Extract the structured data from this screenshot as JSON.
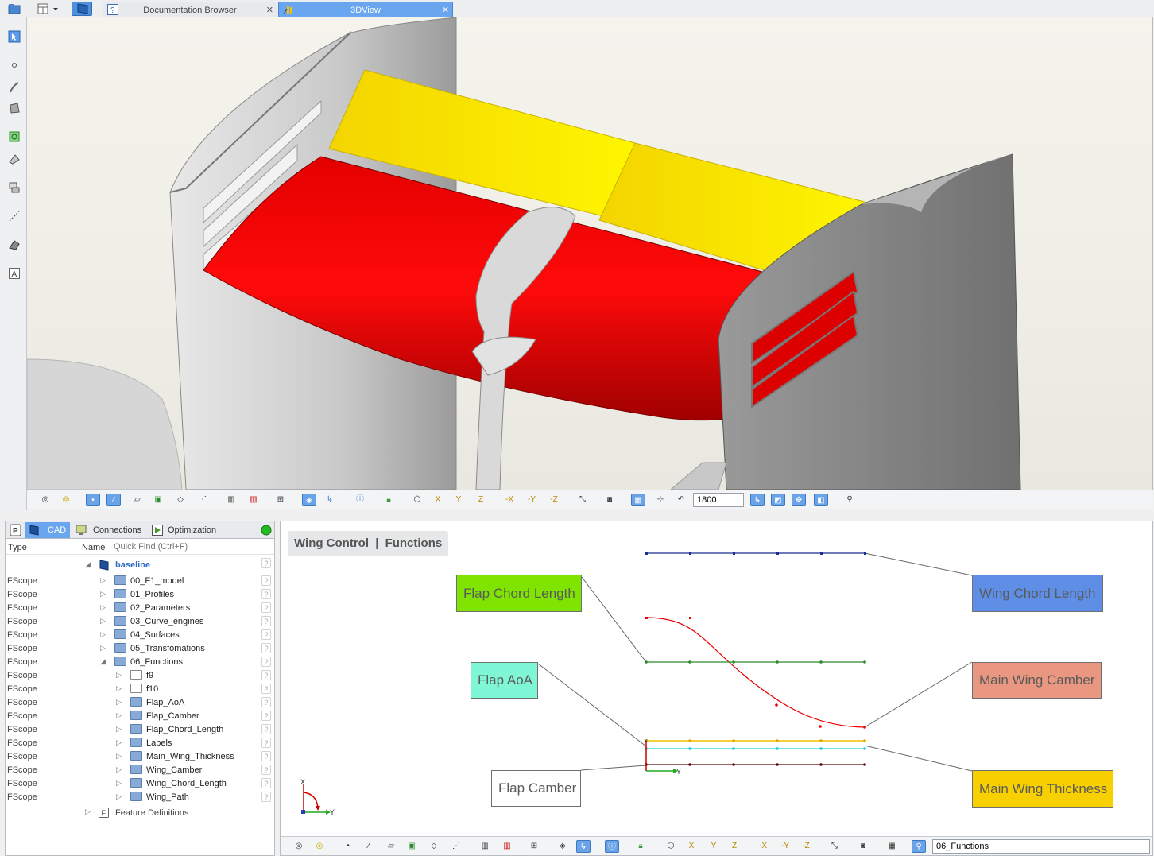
{
  "tabs": {
    "doc": "Documentation Browser",
    "view3d": "3DView"
  },
  "viewport": {
    "zoom_value": "1800",
    "toolbar_labels": [
      "-X",
      "-Y",
      "-Z"
    ],
    "axes": [
      "X",
      "Y",
      "Z"
    ]
  },
  "tree": {
    "tabs": [
      "CAD",
      "Connections",
      "Optimization"
    ],
    "status_color": "#22bb22",
    "columns": {
      "type": "Type",
      "name": "Name",
      "find_placeholder": "Quick Find (Ctrl+F)"
    },
    "root": "baseline",
    "items": [
      {
        "type": "FScope",
        "name": "00_F1_model",
        "level": 1,
        "folder": "blue"
      },
      {
        "type": "FScope",
        "name": "01_Profiles",
        "level": 1,
        "folder": "blue"
      },
      {
        "type": "FScope",
        "name": "02_Parameters",
        "level": 1,
        "folder": "blue"
      },
      {
        "type": "FScope",
        "name": "03_Curve_engines",
        "level": 1,
        "folder": "blue"
      },
      {
        "type": "FScope",
        "name": "04_Surfaces",
        "level": 1,
        "folder": "blue"
      },
      {
        "type": "FScope",
        "name": "05_Transfomations",
        "level": 1,
        "folder": "blue"
      },
      {
        "type": "FScope",
        "name": "06_Functions",
        "level": 1,
        "folder": "blue",
        "expanded": true
      },
      {
        "type": "FScope",
        "name": "f9",
        "level": 2,
        "folder": "empty"
      },
      {
        "type": "FScope",
        "name": "f10",
        "level": 2,
        "folder": "empty"
      },
      {
        "type": "FScope",
        "name": "Flap_AoA",
        "level": 2,
        "folder": "blue"
      },
      {
        "type": "FScope",
        "name": "Flap_Camber",
        "level": 2,
        "folder": "blue"
      },
      {
        "type": "FScope",
        "name": "Flap_Chord_Length",
        "level": 2,
        "folder": "blue"
      },
      {
        "type": "FScope",
        "name": "Labels",
        "level": 2,
        "folder": "blue"
      },
      {
        "type": "FScope",
        "name": "Main_Wing_Thickness",
        "level": 2,
        "folder": "blue"
      },
      {
        "type": "FScope",
        "name": "Wing_Camber",
        "level": 2,
        "folder": "blue"
      },
      {
        "type": "FScope",
        "name": "Wing_Chord_Length",
        "level": 2,
        "folder": "blue"
      },
      {
        "type": "FScope",
        "name": "Wing_Path",
        "level": 2,
        "folder": "blue"
      }
    ],
    "feature_definitions": "Feature Definitions"
  },
  "functions": {
    "breadcrumb_a": "Wing Control",
    "breadcrumb_sep": "|",
    "breadcrumb_b": "Functions",
    "labels": {
      "flap_chord_length": {
        "text": "Flap Chord Length",
        "color": "#7fe400"
      },
      "wing_chord_length": {
        "text": "Wing Chord Length",
        "color": "#5f8ee6"
      },
      "flap_aoa": {
        "text": "Flap AoA",
        "color": "#7ff7d6"
      },
      "main_wing_camber": {
        "text": "Main Wing Camber",
        "color": "#e99781"
      },
      "flap_camber": {
        "text": "Flap Camber",
        "color": "#ffffff"
      },
      "main_wing_thickness": {
        "text": "Main Wing Thickness",
        "color": "#f8d000"
      }
    },
    "axis_x": "X",
    "axis_y": "Y",
    "scope_field": "06_Functions"
  }
}
